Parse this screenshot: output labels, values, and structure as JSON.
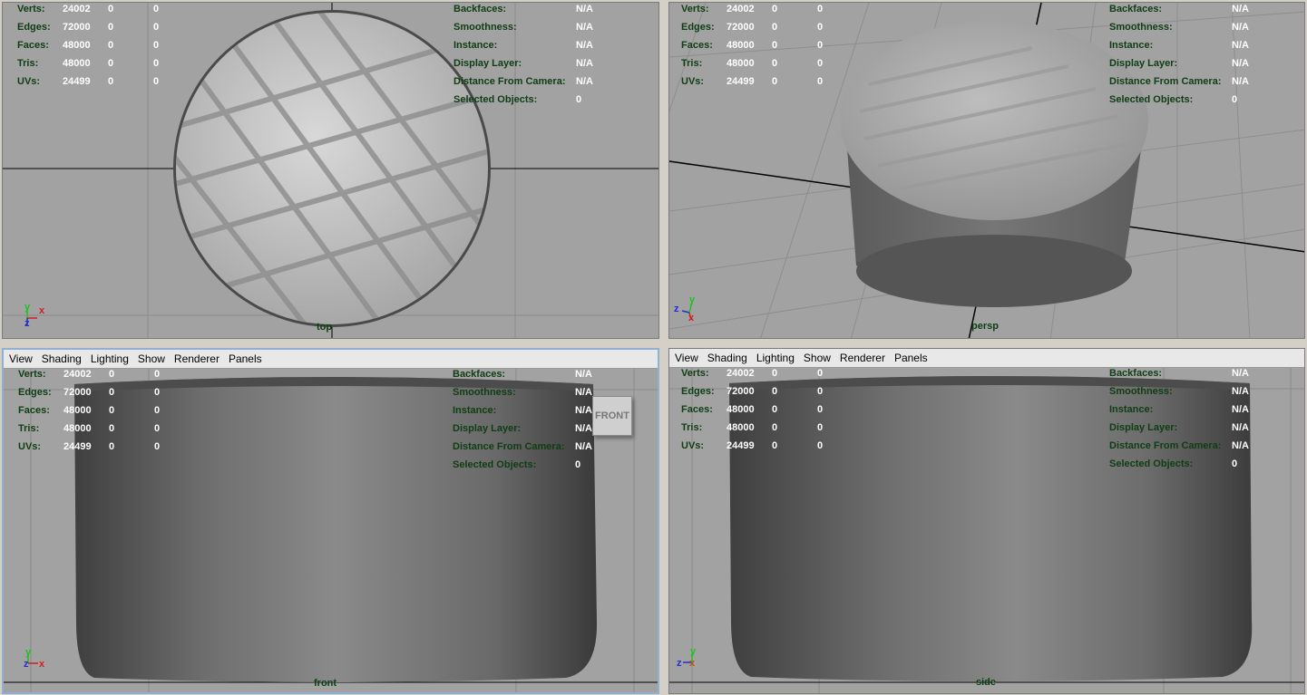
{
  "hud": {
    "rows": [
      {
        "label": "Verts:",
        "a": "24002",
        "b": "0",
        "c": "0"
      },
      {
        "label": "Edges:",
        "a": "72000",
        "b": "0",
        "c": "0"
      },
      {
        "label": "Faces:",
        "a": "48000",
        "b": "0",
        "c": "0"
      },
      {
        "label": "Tris:",
        "a": "48000",
        "b": "0",
        "c": "0"
      },
      {
        "label": "UVs:",
        "a": "24499",
        "b": "0",
        "c": "0"
      }
    ],
    "right": [
      {
        "label": "Backfaces:",
        "value": "N/A"
      },
      {
        "label": "Smoothness:",
        "value": "N/A"
      },
      {
        "label": "Instance:",
        "value": "N/A"
      },
      {
        "label": "Display Layer:",
        "value": "N/A"
      },
      {
        "label": "Distance From Camera:",
        "value": "N/A"
      },
      {
        "label": "Selected Objects:",
        "value": "0"
      }
    ]
  },
  "panel_menu": [
    "View",
    "Shading",
    "Lighting",
    "Show",
    "Renderer",
    "Panels"
  ],
  "viewports": {
    "top": {
      "camera": "top"
    },
    "persp": {
      "camera": "persp"
    },
    "front": {
      "camera": "front"
    },
    "side": {
      "camera": "side"
    }
  },
  "viewcube": {
    "label": "FRONT"
  },
  "axis": {
    "x": "x",
    "y": "y",
    "z": "z"
  },
  "colors": {
    "viewport_bg": "#a2a2a2",
    "hud_label": "#0f3d14",
    "hud_value": "#ffffff",
    "axis_x": "#d02020",
    "axis_y": "#20c020",
    "axis_z": "#2030d0"
  }
}
